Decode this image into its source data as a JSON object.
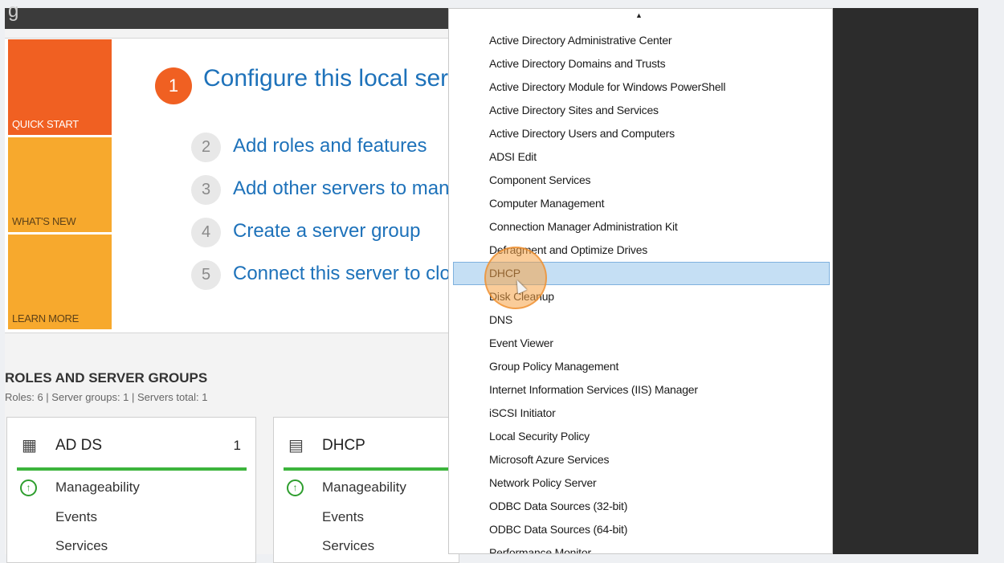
{
  "titlebar": {
    "glyph": "g"
  },
  "tiles": {
    "quick_start": "QUICK START",
    "whats_new": "WHAT'S NEW",
    "learn_more": "LEARN MORE"
  },
  "steps": {
    "step1": {
      "num": "1",
      "text": "Configure this local ser"
    },
    "step2": {
      "num": "2",
      "text": "Add roles and features"
    },
    "step3": {
      "num": "3",
      "text": "Add other servers to man"
    },
    "step4": {
      "num": "4",
      "text": "Create a server group"
    },
    "step5": {
      "num": "5",
      "text": "Connect this server to clo"
    }
  },
  "roles": {
    "title": "ROLES AND SERVER GROUPS",
    "subtitle": "Roles: 6  |  Server groups: 1  |  Servers total: 1"
  },
  "cards": {
    "adds": {
      "title": "AD DS",
      "count": "1",
      "manageability": "Manageability",
      "events": "Events",
      "services": "Services"
    },
    "dhcp": {
      "title": "DHCP",
      "manageability": "Manageability",
      "events": "Events",
      "services": "Services"
    }
  },
  "menu": {
    "scroll_up": "▲",
    "items": [
      "Active Directory Administrative Center",
      "Active Directory Domains and Trusts",
      "Active Directory Module for Windows PowerShell",
      "Active Directory Sites and Services",
      "Active Directory Users and Computers",
      "ADSI Edit",
      "Component Services",
      "Computer Management",
      "Connection Manager Administration Kit",
      "Defragment and Optimize Drives",
      "DHCP",
      "Disk Cleanup",
      "DNS",
      "Event Viewer",
      "Group Policy Management",
      "Internet Information Services (IIS) Manager",
      "iSCSI Initiator",
      "Local Security Policy",
      "Microsoft Azure Services",
      "Network Policy Server",
      "ODBC Data Sources (32-bit)",
      "ODBC Data Sources (64-bit)",
      "Performance Monitor"
    ],
    "selected": "DHCP"
  },
  "colors": {
    "accent_orange": "#f06022",
    "tile_yellow": "#f7a92d",
    "link_blue": "#1e72ba",
    "status_green": "#3cb43c",
    "selection_blue": "#c5dff4"
  }
}
